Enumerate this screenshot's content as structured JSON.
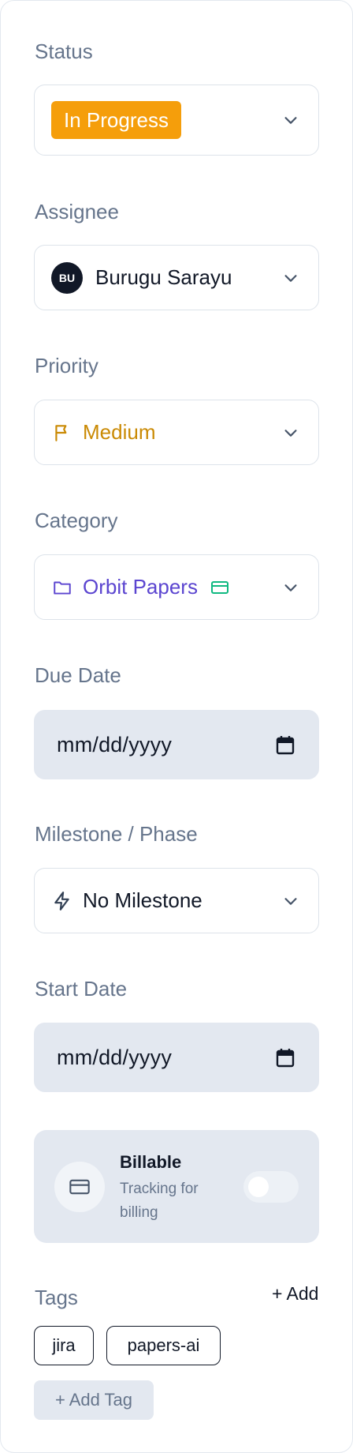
{
  "status": {
    "label": "Status",
    "value": "In Progress",
    "badge_color": "#f59e0b"
  },
  "assignee": {
    "label": "Assignee",
    "initials": "BU",
    "name": "Burugu Sarayu"
  },
  "priority": {
    "label": "Priority",
    "value": "Medium",
    "color": "#ca8a04",
    "icon": "flag-icon"
  },
  "category": {
    "label": "Category",
    "value": "Orbit Papers",
    "color": "#5b45d0",
    "icon": "folder-icon",
    "secondary_icon": "card-icon",
    "secondary_color": "#10b981"
  },
  "due_date": {
    "label": "Due Date",
    "placeholder": "mm/dd/yyyy"
  },
  "milestone": {
    "label": "Milestone / Phase",
    "value": "No Milestone",
    "icon": "lightning-icon"
  },
  "start_date": {
    "label": "Start Date",
    "placeholder": "mm/dd/yyyy"
  },
  "billable": {
    "title": "Billable",
    "subtitle": "Tracking for billing",
    "enabled": false
  },
  "tags": {
    "label": "Tags",
    "add_link": "+ Add",
    "items": [
      "jira",
      "papers-ai"
    ],
    "add_button": "+ Add Tag"
  }
}
